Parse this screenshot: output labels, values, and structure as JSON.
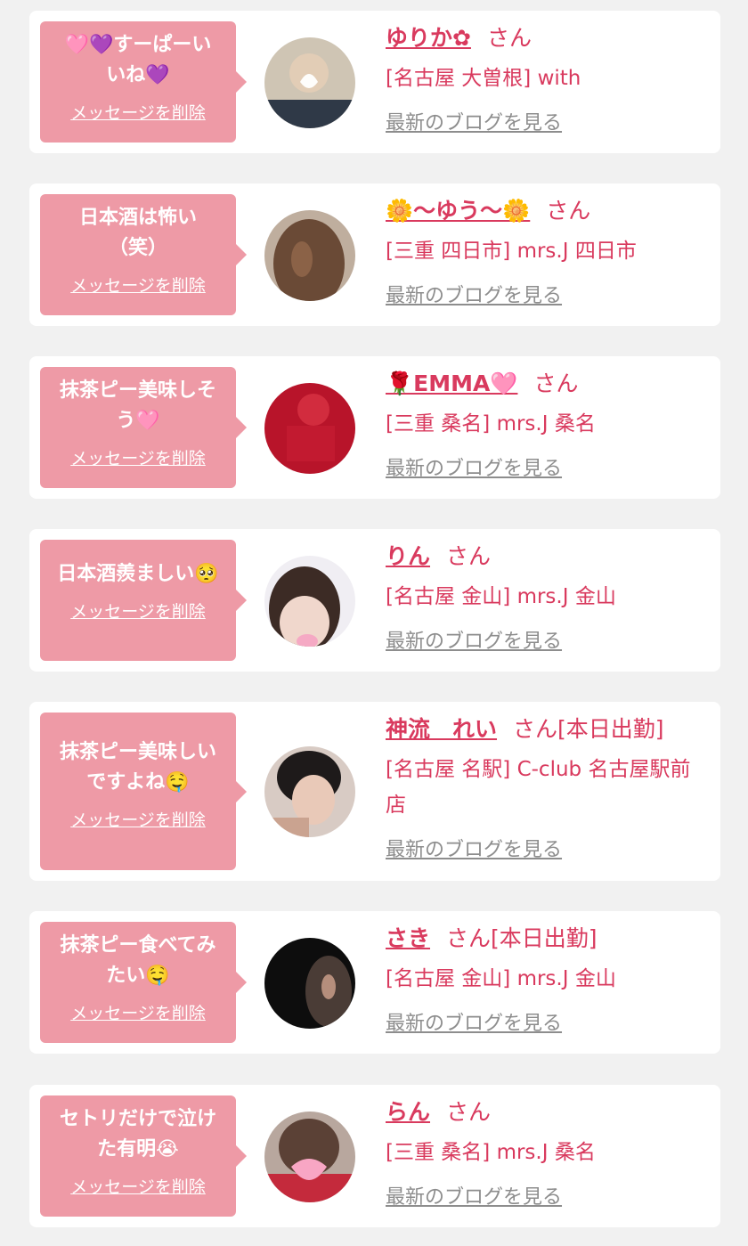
{
  "colors": {
    "accent": "#d93a5e",
    "bubble": "#ee9aa6",
    "link_gray": "#8d8d8d",
    "background": "#f1f1f1"
  },
  "delete_label": "メッセージを削除",
  "blog_label": "最新のブログを見る",
  "items": [
    {
      "message_line1": "🩷💜すーぱーい",
      "message_line2": "いね💜",
      "name": "ゆりか✿",
      "suffix": "さん",
      "shop": "[名古屋 大曽根] with"
    },
    {
      "message_line1": "日本酒は怖い",
      "message_line2": "（笑）",
      "name": "🌼〜ゆう〜🌼",
      "suffix": "さん",
      "shop": "[三重 四日市] mrs.J 四日市"
    },
    {
      "message_line1": "抹茶ピー美味しそ",
      "message_line2": "う🩷",
      "name": "🌹EMMA🩷",
      "suffix": "さん",
      "shop": "[三重 桑名] mrs.J 桑名"
    },
    {
      "message_line1": "日本酒羨ましい🥺",
      "message_line2": "",
      "name": "りん",
      "suffix": "さん",
      "shop": "[名古屋 金山] mrs.J 金山"
    },
    {
      "message_line1": "抹茶ピー美味しい",
      "message_line2": "ですよね🤤",
      "name": "神流　れい",
      "suffix": "さん[本日出勤]",
      "shop": "[名古屋 名駅] C-club 名古屋駅前店"
    },
    {
      "message_line1": "抹茶ピー食べてみ",
      "message_line2": "たい🤤",
      "name": "さき",
      "suffix": "さん[本日出勤]",
      "shop": "[名古屋 金山] mrs.J 金山"
    },
    {
      "message_line1": "セトリだけで泣け",
      "message_line2": "た有明😭",
      "name": "らん",
      "suffix": "さん",
      "shop": "[三重 桑名] mrs.J 桑名"
    }
  ]
}
